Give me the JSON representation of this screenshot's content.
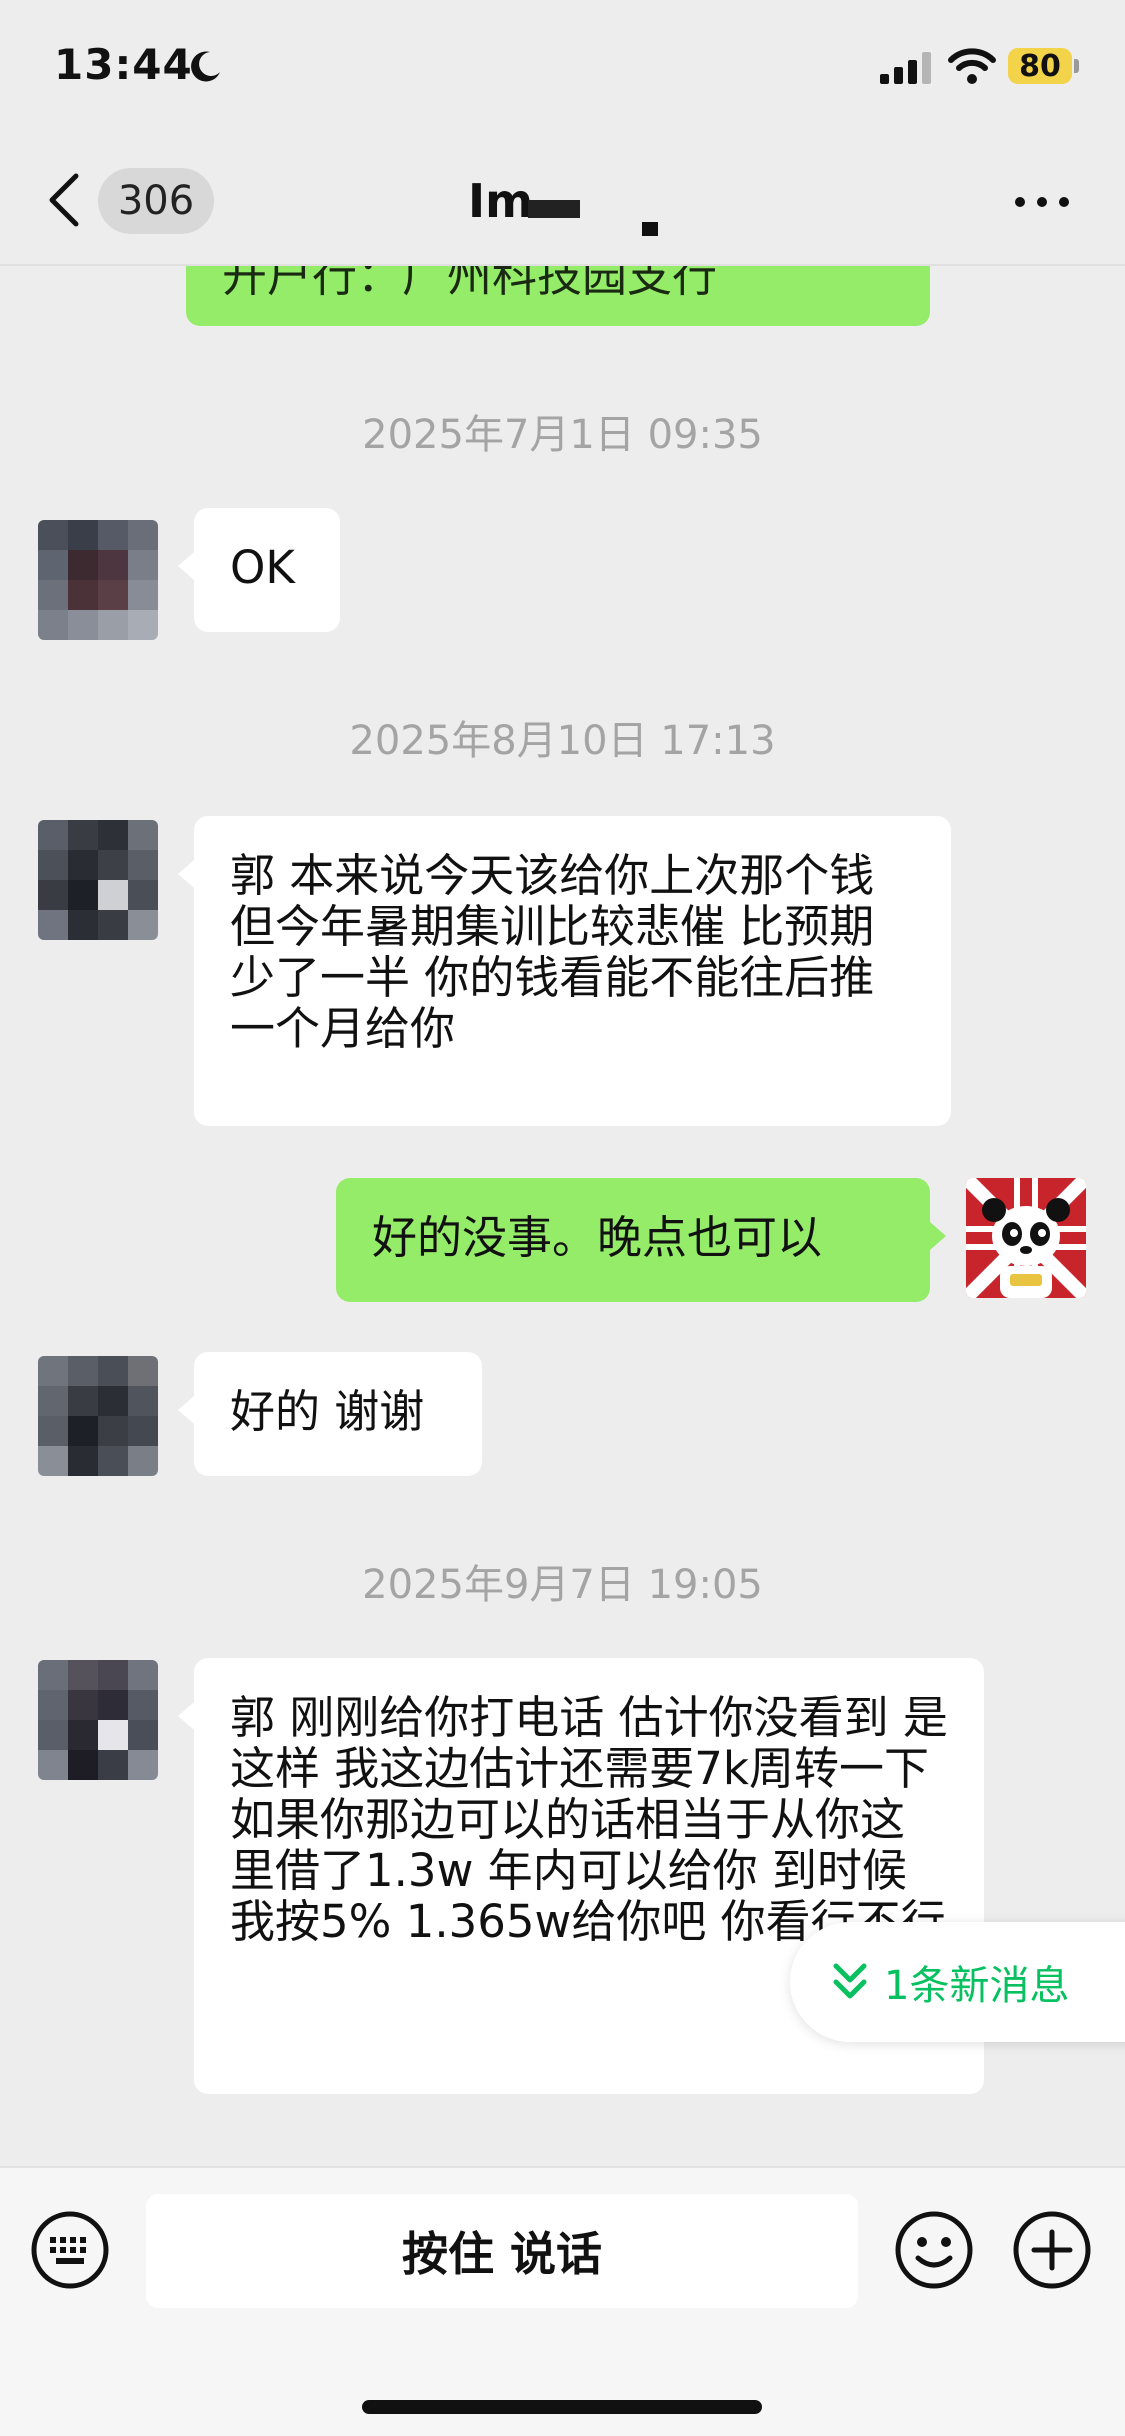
{
  "status_bar": {
    "time": "13:44",
    "battery": "80"
  },
  "nav": {
    "unread_count": "306",
    "title": "Im"
  },
  "messages": {
    "top_partial_text": "开户行：广州科技园支行",
    "ts1": "2025年7月1日 09:35",
    "msg1": "OK",
    "ts2": "2025年8月10日 17:13",
    "msg2": "郭 本来说今天该给你上次那个钱 但今年暑期集训比较悲催 比预期少了一半 你的钱看能不能往后推一个月给你",
    "msg3": "好的没事。晚点也可以",
    "msg4": "好的 谢谢",
    "ts3": "2025年9月7日 19:05",
    "msg5": "郭 刚刚给你打电话 估计你没看到 是这样 我这边估计还需要7k周转一下 如果你那边可以的话相当于从你这里借了1.3w 年内可以给你 到时候我按5% 1.365w给你吧 你看行不行"
  },
  "new_message_pill": {
    "label": "1条新消息",
    "color": "#07c160"
  },
  "input_bar": {
    "voice_label": "按住 说话"
  },
  "icons": {
    "moon": "moon-icon",
    "signal": "signal-icon",
    "wifi": "wifi-icon",
    "back": "chevron-left-icon",
    "more": "more-dots-icon",
    "keyboard": "keyboard-icon",
    "emoji": "emoji-icon",
    "plus": "plus-icon",
    "chevrons": "double-chevron-down-icon"
  },
  "colors": {
    "background": "#ededed",
    "outgoing_bubble": "#95ec69",
    "incoming_bubble": "#ffffff",
    "timestamp": "#a4a4a4"
  }
}
